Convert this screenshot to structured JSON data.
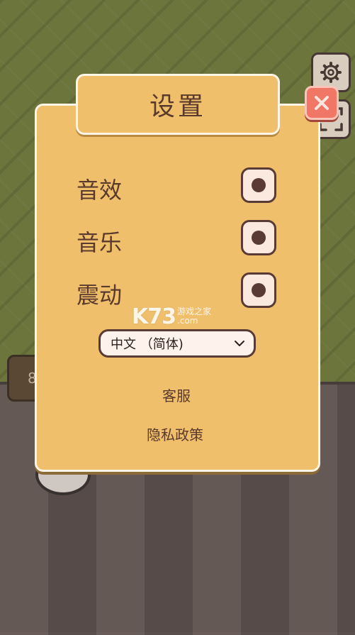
{
  "background": {
    "floor_badge_text": "8"
  },
  "dialog": {
    "title": "设置",
    "options": [
      {
        "label": "音效",
        "enabled": true
      },
      {
        "label": "音乐",
        "enabled": true
      },
      {
        "label": "震动",
        "enabled": true
      }
    ],
    "language_select": {
      "value": "中文 （简体)"
    },
    "customer_service_label": "客服",
    "privacy_policy_label": "隐私政策"
  },
  "watermark": {
    "logo": "K73",
    "line1": "游戏之家",
    "line2": ".com"
  },
  "icons": [
    "gear-icon",
    "frame-icon",
    "close-icon",
    "chevron-down-icon"
  ],
  "colors": {
    "panel": "#f0bf6c",
    "panel_border": "#fdf5e6",
    "text": "#5a3a2c",
    "close": "#f07766",
    "wall": "#717a3f",
    "floor": "#5e5351"
  }
}
